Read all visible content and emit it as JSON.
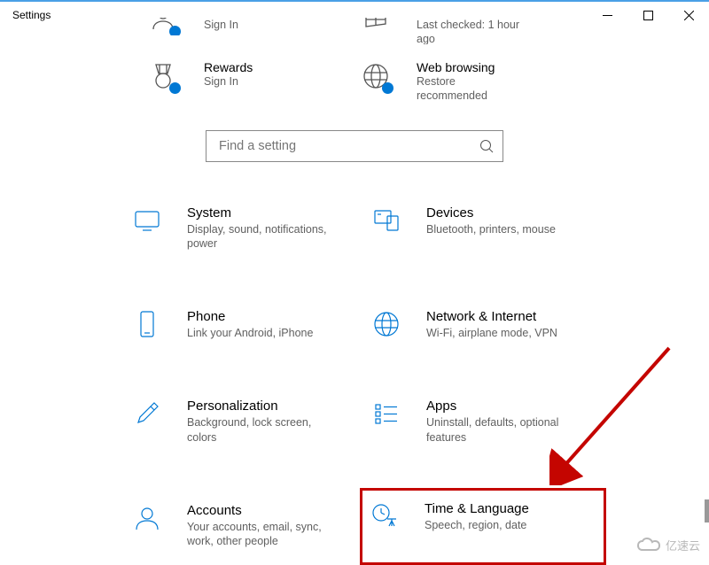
{
  "window": {
    "title": "Settings"
  },
  "status": {
    "microsoft": {
      "title": "",
      "sub": "Sign In"
    },
    "update": {
      "title": "",
      "sub": "Last checked: 1 hour ago"
    },
    "rewards": {
      "title": "Rewards",
      "sub": "Sign In"
    },
    "web": {
      "title": "Web browsing",
      "sub": "Restore recommended"
    }
  },
  "search": {
    "placeholder": "Find a setting"
  },
  "tiles": {
    "system": {
      "title": "System",
      "sub": "Display, sound, notifications, power"
    },
    "devices": {
      "title": "Devices",
      "sub": "Bluetooth, printers, mouse"
    },
    "phone": {
      "title": "Phone",
      "sub": "Link your Android, iPhone"
    },
    "network": {
      "title": "Network & Internet",
      "sub": "Wi-Fi, airplane mode, VPN"
    },
    "personal": {
      "title": "Personalization",
      "sub": "Background, lock screen, colors"
    },
    "apps": {
      "title": "Apps",
      "sub": "Uninstall, defaults, optional features"
    },
    "accounts": {
      "title": "Accounts",
      "sub": "Your accounts, email, sync, work, other people"
    },
    "time": {
      "title": "Time & Language",
      "sub": "Speech, region, date"
    }
  },
  "watermark": "亿速云"
}
